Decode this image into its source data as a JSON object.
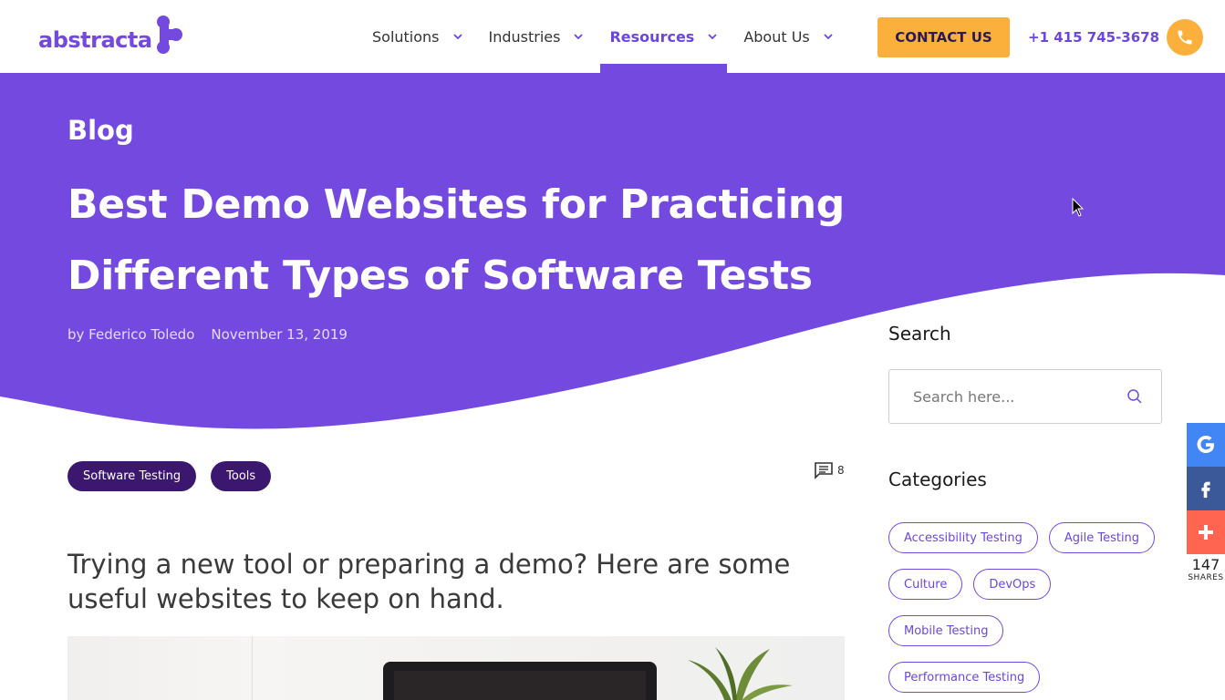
{
  "brand": {
    "name": "abstracta",
    "color": "#7349df",
    "accent": "#fbb03b"
  },
  "nav": {
    "items": [
      {
        "label": "Solutions",
        "active": false
      },
      {
        "label": "Industries",
        "active": false
      },
      {
        "label": "Resources",
        "active": true
      },
      {
        "label": "About Us",
        "active": false
      }
    ],
    "contact_label": "CONTACT US",
    "phone": "+1 415 745-3678",
    "phone_icon": "phone-icon"
  },
  "hero": {
    "section": "Blog",
    "title_line1": "Best Demo Websites for Practicing",
    "title_line2": "Different Types of Software Tests",
    "author": "by Federico Toledo",
    "date": "November 13, 2019",
    "background": "#7349df"
  },
  "post": {
    "tags": [
      "Software Testing",
      "Tools"
    ],
    "comment_count": "8",
    "lead": "Trying a new tool or preparing a demo? Here are some useful websites to keep on hand."
  },
  "sidebar": {
    "search_heading": "Search",
    "search_placeholder": "Search here...",
    "categories_heading": "Categories",
    "categories": [
      "Accessibility Testing",
      "Agile Testing",
      "Culture",
      "DevOps",
      "Mobile Testing",
      "Performance Testing"
    ]
  },
  "share": {
    "count": "147",
    "label": "SHARES",
    "buttons": [
      {
        "name": "google",
        "color": "#4285f4"
      },
      {
        "name": "facebook",
        "color": "#3b5998"
      },
      {
        "name": "more",
        "color": "#ff6550"
      }
    ]
  }
}
